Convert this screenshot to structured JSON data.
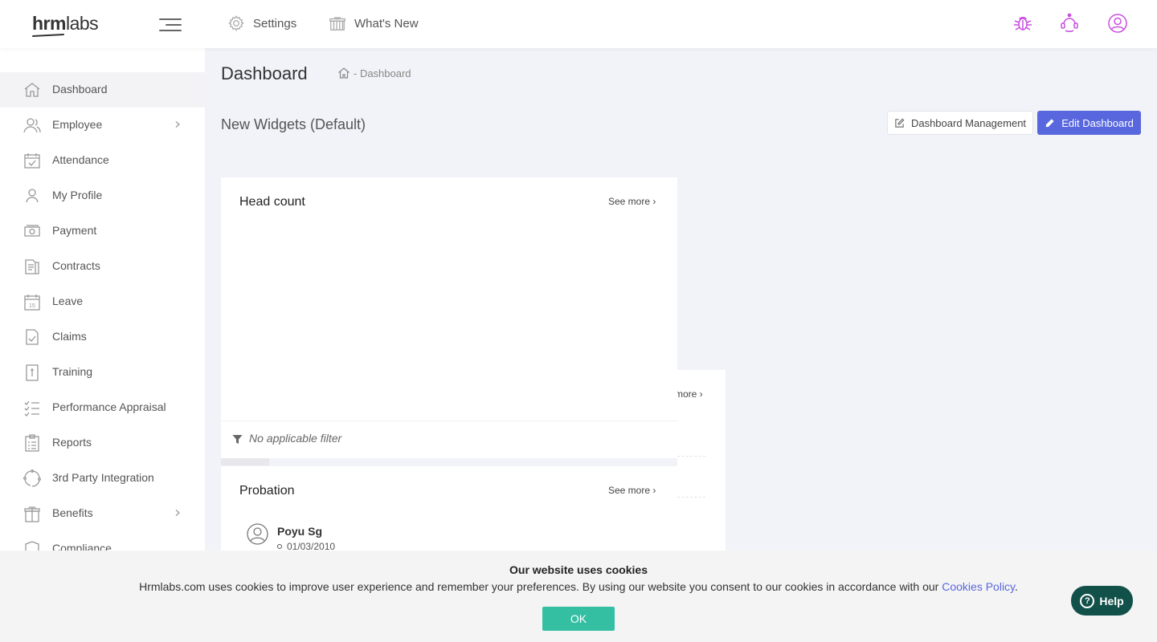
{
  "header": {
    "logo_bold": "hrm",
    "logo_light": "labs",
    "settings_label": "Settings",
    "whats_new_label": "What's New",
    "icons": [
      "bug-icon",
      "support-icon",
      "user-account-icon"
    ]
  },
  "sidebar": {
    "items": [
      {
        "label": "Dashboard",
        "icon": "home-icon",
        "active": true
      },
      {
        "label": "Employee",
        "icon": "employee-icon",
        "chevron": true
      },
      {
        "label": "Attendance",
        "icon": "attendance-icon"
      },
      {
        "label": "My Profile",
        "icon": "profile-icon"
      },
      {
        "label": "Payment",
        "icon": "payment-icon"
      },
      {
        "label": "Contracts",
        "icon": "contracts-icon"
      },
      {
        "label": "Leave",
        "icon": "leave-calendar-icon"
      },
      {
        "label": "Claims",
        "icon": "claims-icon"
      },
      {
        "label": "Training",
        "icon": "training-icon"
      },
      {
        "label": "Performance Appraisal",
        "icon": "appraisal-icon"
      },
      {
        "label": "Reports",
        "icon": "reports-icon"
      },
      {
        "label": "3rd Party Integration",
        "icon": "integration-icon"
      },
      {
        "label": "Benefits",
        "icon": "benefits-icon",
        "chevron": true
      },
      {
        "label": "Compliance",
        "icon": "compliance-icon"
      }
    ]
  },
  "main": {
    "title": "Dashboard",
    "breadcrumb": "- Dashboard",
    "subtitle": "New Widgets (Default)",
    "dashboard_management_label": "Dashboard Management",
    "edit_dashboard_label": "Edit Dashboard",
    "headcount": {
      "title": "Head count",
      "see_more": "See more",
      "filter": "No applicable filter"
    },
    "behind_card": {
      "see_more_partial": "more"
    },
    "probation": {
      "title": "Probation",
      "see_more": "See more",
      "person_name": "Poyu Sg",
      "person_date": "01/03/2010"
    }
  },
  "cookie": {
    "title": "Our website uses cookies",
    "text": "Hrmlabs.com uses cookies to improve user experience and remember your preferences. By using our website you consent to our cookies in accordance with our ",
    "link": "Cookies Policy",
    "period": ".",
    "ok": "OK"
  },
  "help": {
    "label": "Help"
  },
  "colors": {
    "accent": "#5867dd",
    "ok_green": "#34bfa3",
    "help_dark": "#12514a",
    "icon_purple": "#c94fe0"
  }
}
